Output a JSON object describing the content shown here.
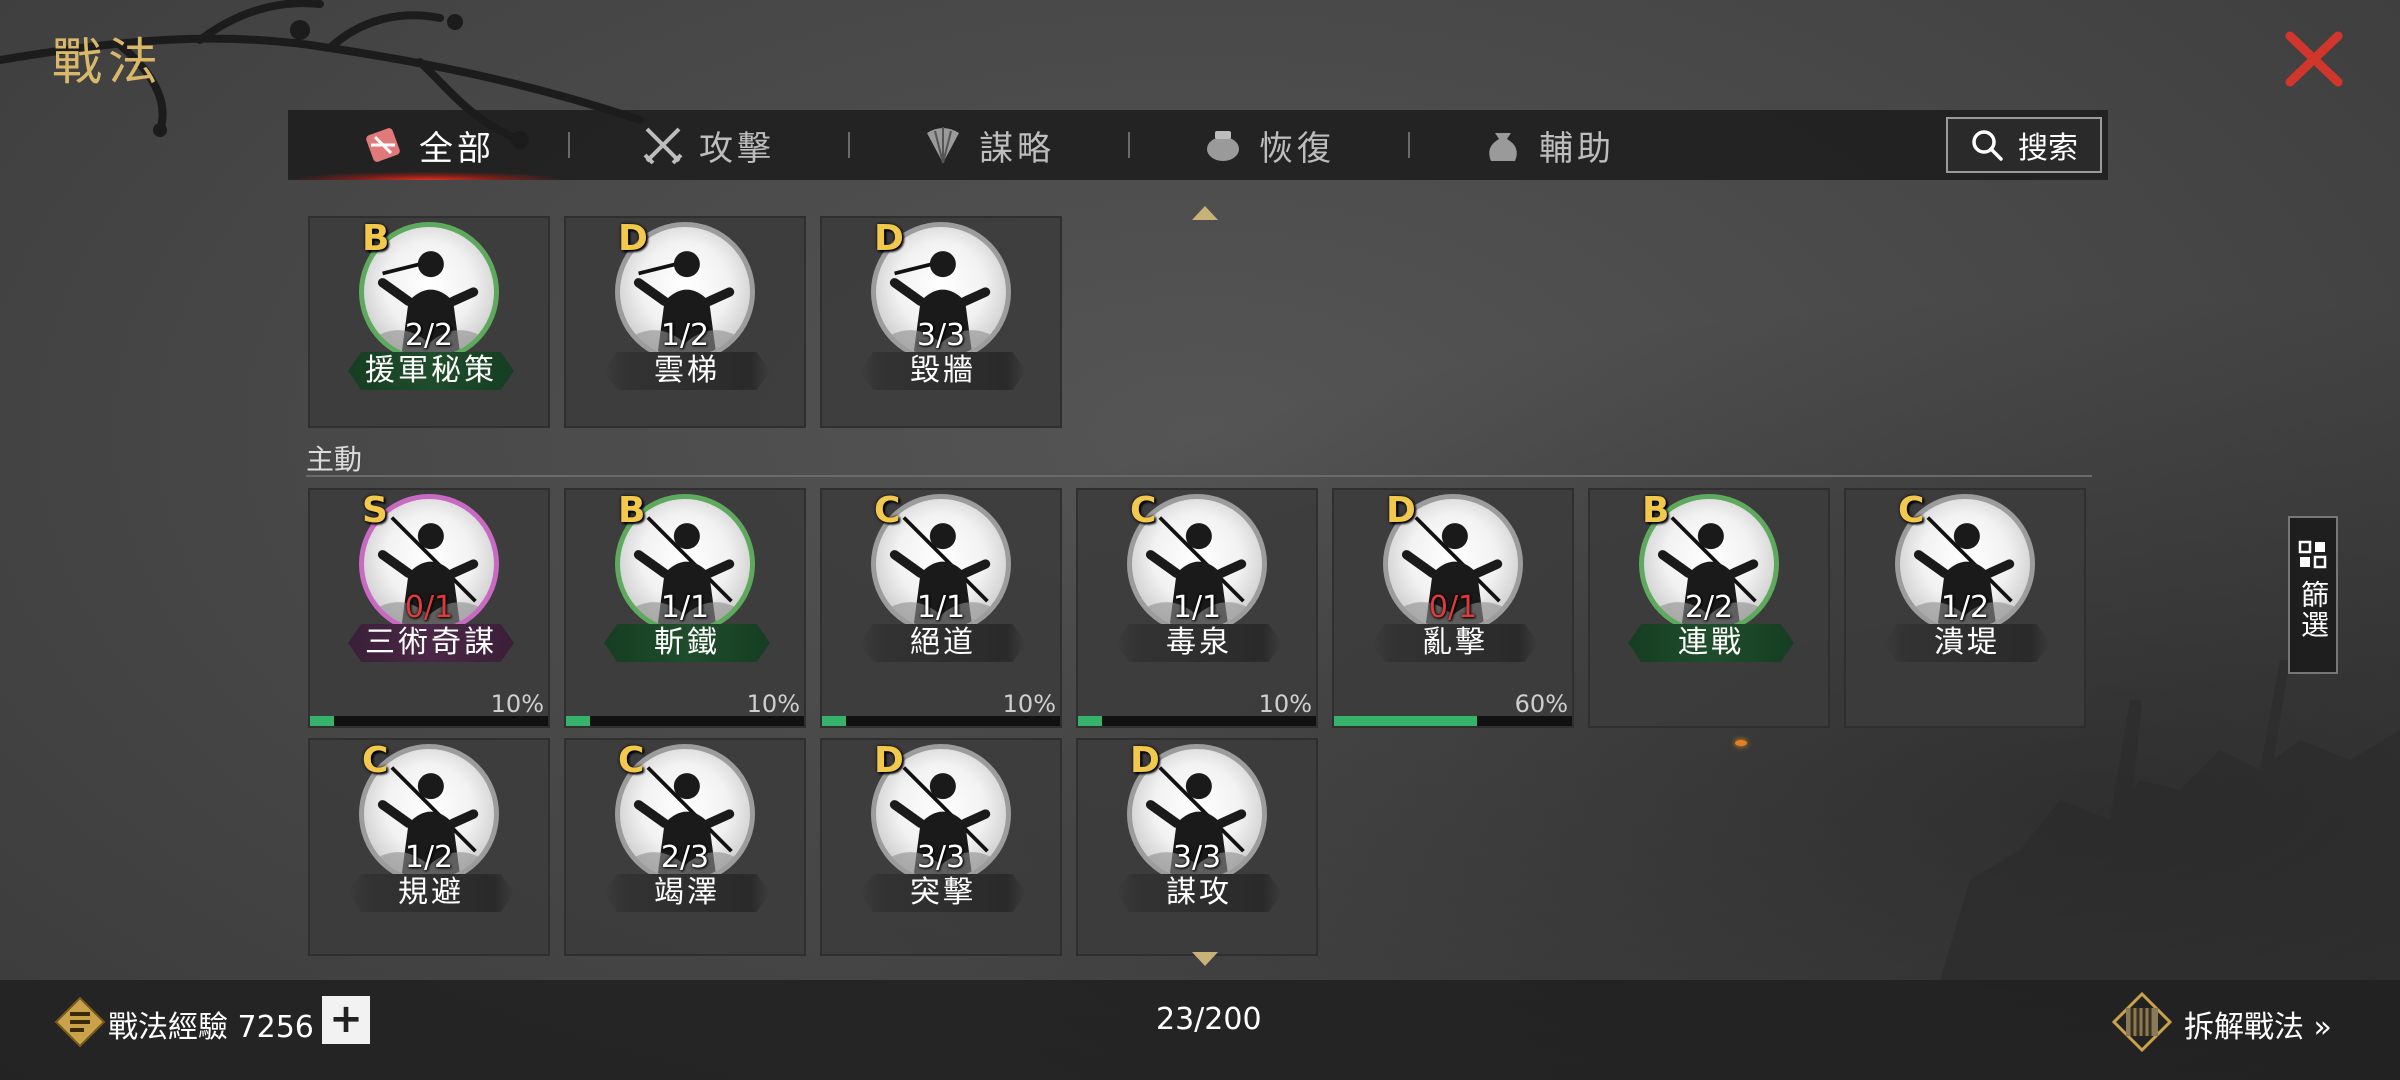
{
  "page": {
    "title": "戰法"
  },
  "tabs": [
    {
      "label": "全部",
      "icon": "all-scroll-icon",
      "active": true
    },
    {
      "label": "攻擊",
      "icon": "crossed-swords-icon",
      "active": false
    },
    {
      "label": "謀略",
      "icon": "feather-fan-icon",
      "active": false
    },
    {
      "label": "恢復",
      "icon": "pill-jar-icon",
      "active": false
    },
    {
      "label": "輔助",
      "icon": "pouch-icon",
      "active": false
    }
  ],
  "search": {
    "label": "搜索"
  },
  "sections": {
    "passive_row": [
      {
        "grade": "B",
        "count": "2/2",
        "name": "援軍秘策",
        "count_warn": false
      },
      {
        "grade": "D",
        "count": "1/2",
        "name": "雲梯",
        "count_warn": false
      },
      {
        "grade": "D",
        "count": "3/3",
        "name": "毀牆",
        "count_warn": false
      }
    ],
    "active_label": "主動",
    "active_row1": [
      {
        "grade": "S",
        "count": "0/1",
        "name": "三術奇謀",
        "count_warn": true,
        "progress": 0.1,
        "progress_label": "10%"
      },
      {
        "grade": "B",
        "count": "1/1",
        "name": "斬鐵",
        "count_warn": false,
        "progress": 0.1,
        "progress_label": "10%"
      },
      {
        "grade": "C",
        "count": "1/1",
        "name": "絕道",
        "count_warn": false,
        "progress": 0.1,
        "progress_label": "10%"
      },
      {
        "grade": "C",
        "count": "1/1",
        "name": "毒泉",
        "count_warn": false,
        "progress": 0.1,
        "progress_label": "10%"
      },
      {
        "grade": "D",
        "count": "0/1",
        "name": "亂擊",
        "count_warn": true,
        "progress": 0.6,
        "progress_label": "60%"
      },
      {
        "grade": "B",
        "count": "2/2",
        "name": "連戰",
        "count_warn": false
      },
      {
        "grade": "C",
        "count": "1/2",
        "name": "潰堤",
        "count_warn": false
      }
    ],
    "active_row2": [
      {
        "grade": "C",
        "count": "1/2",
        "name": "規避",
        "count_warn": false
      },
      {
        "grade": "C",
        "count": "2/3",
        "name": "竭澤",
        "count_warn": false
      },
      {
        "grade": "D",
        "count": "3/3",
        "name": "突擊",
        "count_warn": false
      },
      {
        "grade": "D",
        "count": "3/3",
        "name": "謀攻",
        "count_warn": false
      }
    ]
  },
  "filter": {
    "label": "篩選"
  },
  "footer": {
    "exp_label": "戰法經驗 7256",
    "plus": "+",
    "inventory": "23/200",
    "dismantle": "拆解戰法 »"
  },
  "colors": {
    "accent_gold": "#d9b86a",
    "close_red": "#d0362c",
    "progress_green": "#36b36a",
    "warn_red": "#e03a3a"
  }
}
